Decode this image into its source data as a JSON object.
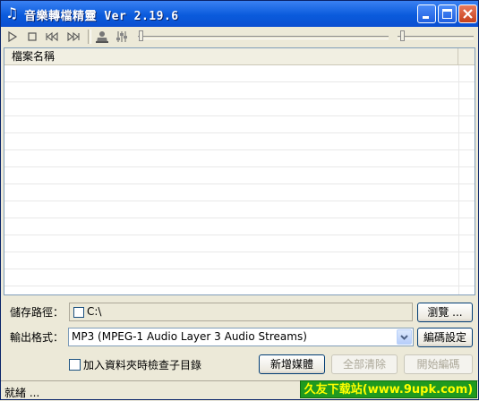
{
  "window": {
    "title": "音樂轉檔精靈 Ver 2.19.6",
    "icon": "music-note-icon"
  },
  "toolbar": {
    "icons": [
      "play-icon",
      "stop-icon",
      "previous-icon",
      "next-icon",
      "user-icon",
      "equalizer-icon"
    ]
  },
  "filelist": {
    "column_header": "檔案名稱",
    "rows": []
  },
  "output": {
    "path_label": "儲存路徑：",
    "path_value": "C:\\",
    "browse_button": "瀏覽 ...",
    "format_label": "輸出格式：",
    "format_value": "MP3 (MPEG-1 Audio Layer 3 Audio Streams)",
    "encode_settings_button": "編碼設定"
  },
  "actions": {
    "include_subfolders_label": "加入資料夾時檢查子目錄",
    "include_subfolders_checked": false,
    "add_media_button": "新增媒體",
    "clear_all_button": "全部清除",
    "start_encode_button": "開始編碼"
  },
  "status": {
    "text": "就緒 ...",
    "watermark": "久友下载站(www.9upk.com)"
  },
  "colors": {
    "titlebar": "#0a5bdc",
    "watermark_bg": "#1f9a1f",
    "watermark_text": "#ffff00"
  }
}
